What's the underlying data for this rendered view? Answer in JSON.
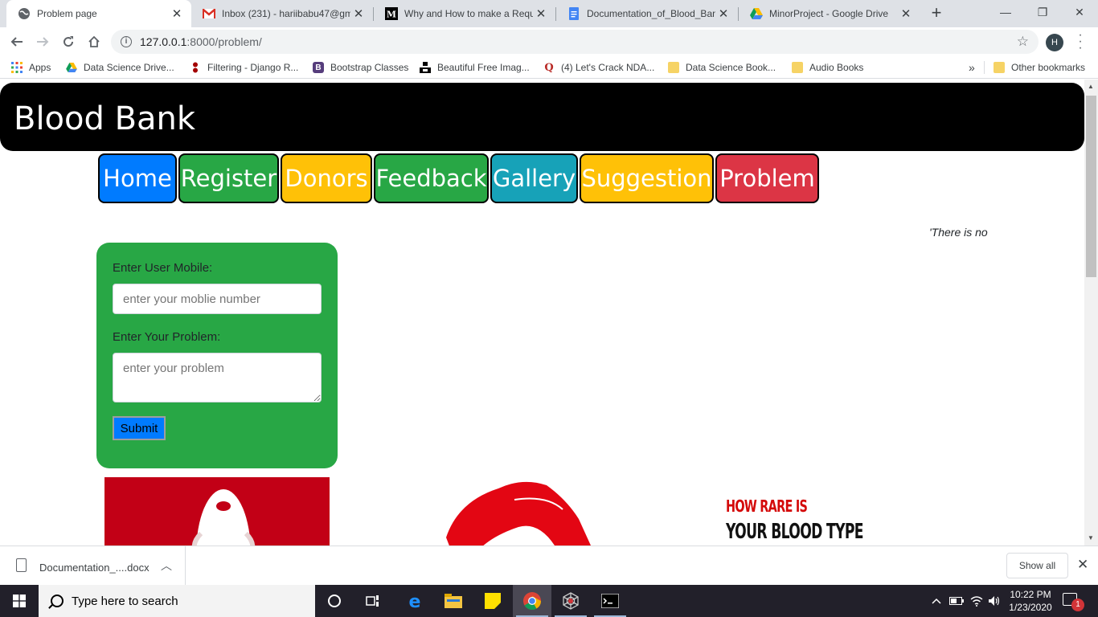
{
  "browser": {
    "tabs": [
      {
        "title": "Problem page",
        "active": true
      },
      {
        "title": "Inbox (231) - hariibabu47@gmail.com",
        "active": false
      },
      {
        "title": "Why and How to make a Request",
        "active": false
      },
      {
        "title": "Documentation_of_Blood_Bank",
        "active": false
      },
      {
        "title": "MinorProject - Google Drive",
        "active": false
      }
    ],
    "close_glyph": "✕",
    "new_tab_glyph": "+",
    "window_controls": {
      "minimize": "—",
      "restore": "❐",
      "close": "✕"
    },
    "url_host": "127.0.0.1",
    "url_path": ":8000/problem/",
    "profile_initial": "H",
    "bookmarks": [
      {
        "label": "Apps"
      },
      {
        "label": "Data Science Drive..."
      },
      {
        "label": "Filtering - Django R..."
      },
      {
        "label": "Bootstrap Classes"
      },
      {
        "label": "Beautiful Free Imag..."
      },
      {
        "label": "(4) Let's Crack NDA..."
      },
      {
        "label": "Data Science Book..."
      },
      {
        "label": "Audio Books"
      }
    ],
    "overflow_glyph": "»",
    "other_bookmarks": "Other bookmarks"
  },
  "site": {
    "brand": "Blood Bank",
    "nav": [
      {
        "label": "Home",
        "color": "#007bff"
      },
      {
        "label": "Register",
        "color": "#28a745"
      },
      {
        "label": "Donors",
        "color": "#ffc107"
      },
      {
        "label": "Feedback",
        "color": "#28a745"
      },
      {
        "label": "Gallery",
        "color": "#17a2b8"
      },
      {
        "label": "Suggestion",
        "color": "#ffc107"
      },
      {
        "label": "Problem",
        "color": "#dc3545"
      }
    ],
    "marquee_text": "'There is no",
    "form": {
      "mobile_label": "Enter User Mobile:",
      "mobile_placeholder": "enter your moblie number",
      "problem_label": "Enter Your Problem:",
      "problem_placeholder": "enter your problem",
      "submit_label": "Submit"
    },
    "poster_line1": "HOW RARE IS",
    "poster_line2": "YOUR BLOOD TYPE"
  },
  "downloads": {
    "file_name": "Documentation_....docx",
    "show_all": "Show all",
    "close_glyph": "✕"
  },
  "taskbar": {
    "search_placeholder": "Type here to search",
    "time": "10:22 PM",
    "date": "1/23/2020",
    "notification_count": "1"
  }
}
